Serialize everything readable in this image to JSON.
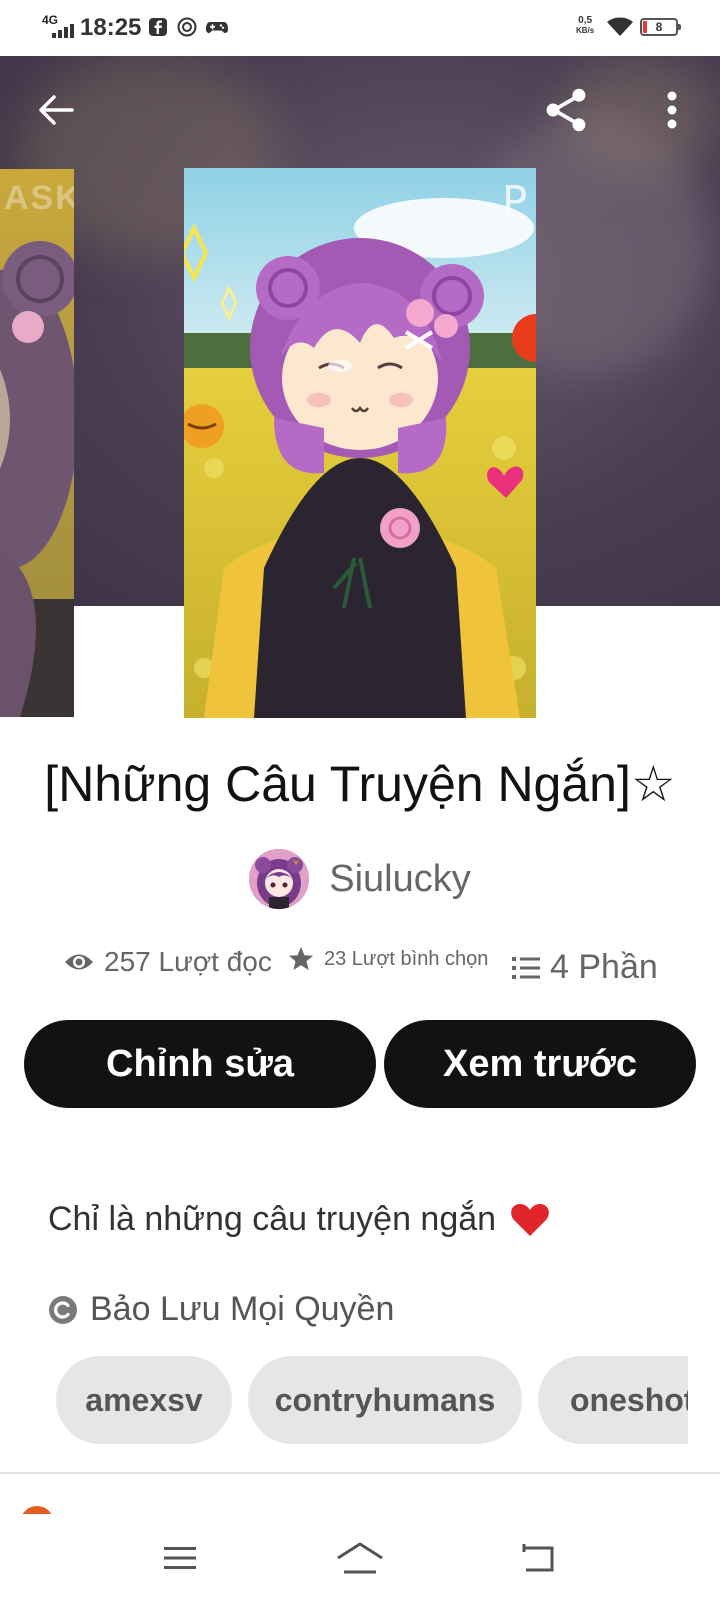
{
  "status_bar": {
    "network": "4G",
    "time": "18:25",
    "speed_value": "0,5",
    "speed_unit": "KB/s",
    "battery": "8",
    "app_icons": [
      "facebook-icon",
      "messenger-icon",
      "gamepad-icon"
    ]
  },
  "header": {
    "back_icon": "arrow-left-icon",
    "share_icon": "share-icon",
    "more_icon": "more-vertical-icon",
    "side_cover_text": "ASK"
  },
  "story": {
    "title": "[Những Câu Truyện Ngắn]☆",
    "author": "Siulucky",
    "stats": {
      "reads": "257 Lượt đọc",
      "votes": "23 Lượt bình chọn",
      "parts": "4 Phần"
    },
    "description": "Chỉ là những câu truyện ngắn",
    "description_emoji": "❤️",
    "copyright": "Bảo Lưu Mọi Quyền",
    "tags": [
      "amexsv",
      "contryhumans",
      "oneshot"
    ]
  },
  "actions": {
    "edit_label": "Chỉnh sửa",
    "preview_label": "Xem trước"
  },
  "colors": {
    "button_bg": "#121212",
    "tag_bg": "#e6e6e6",
    "hero_bg": "#4a3d52",
    "heart": "#e0252b"
  }
}
